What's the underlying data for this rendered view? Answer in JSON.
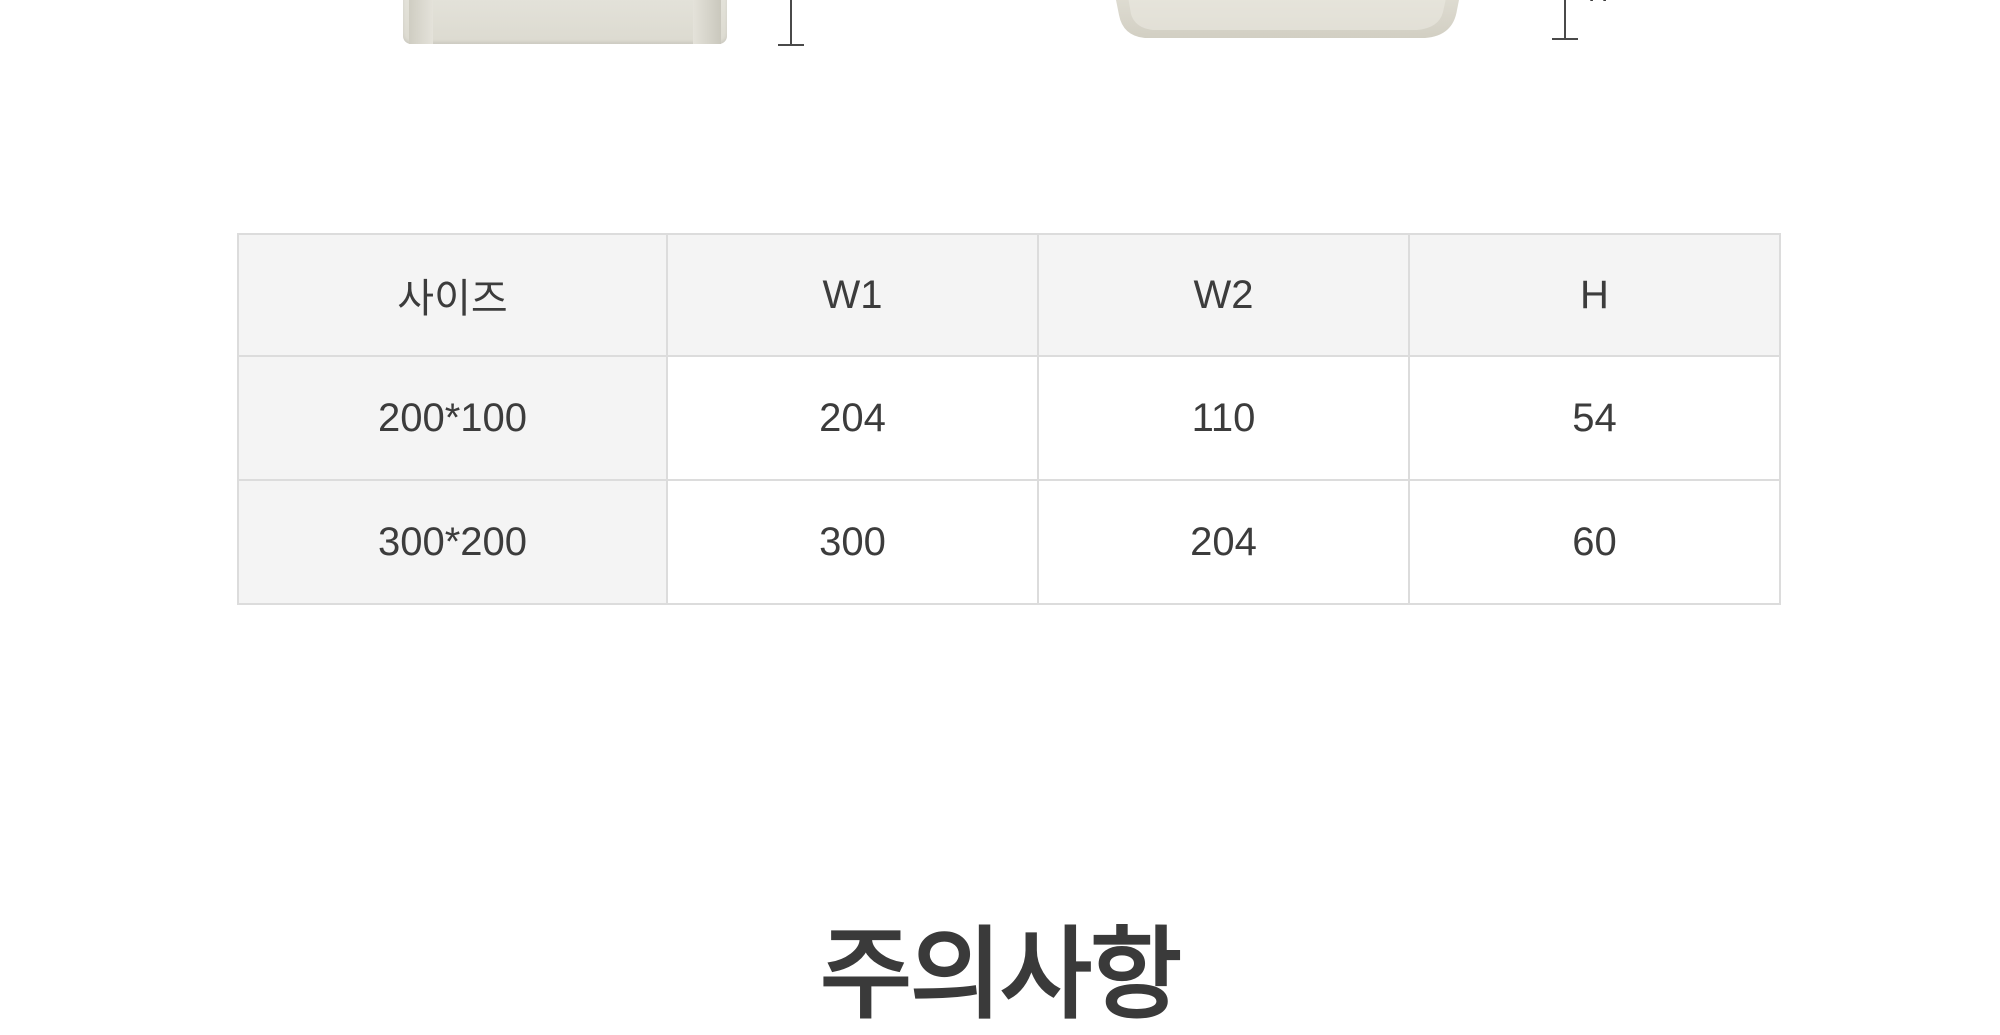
{
  "illustration": {
    "left_product": "tray-front-view-icon",
    "right_product": "tray-side-view-icon",
    "height_marker_label": "H"
  },
  "size_table": {
    "headers": [
      "사이즈",
      "W1",
      "W2",
      "H"
    ],
    "rows": [
      [
        "200*100",
        "204",
        "110",
        "54"
      ],
      [
        "300*200",
        "300",
        "204",
        "60"
      ]
    ],
    "colors": {
      "header_bg": "#f4f4f4",
      "border": "#dcdcdc",
      "text": "#3c3c3c"
    }
  },
  "section": {
    "title": "주의사항"
  }
}
